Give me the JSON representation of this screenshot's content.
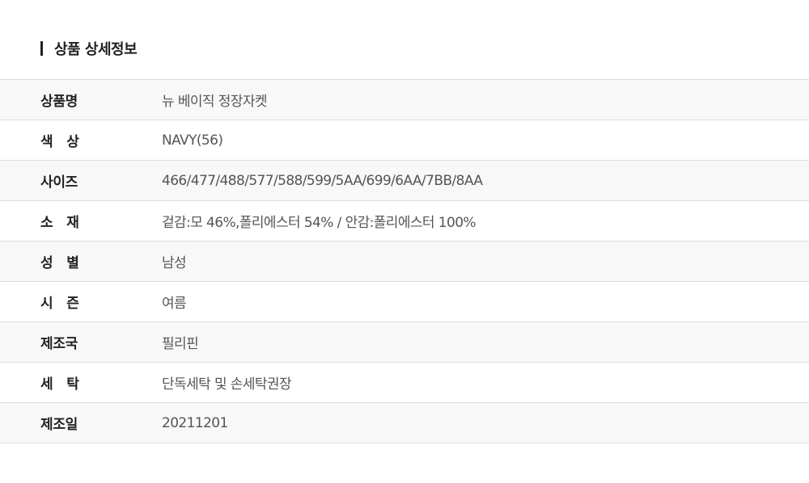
{
  "section": {
    "title": "상품 상세정보"
  },
  "rows": [
    {
      "label": "상품명",
      "value": "뉴 베이직 정장자켓"
    },
    {
      "label": "색   상",
      "value": "NAVY(56)"
    },
    {
      "label": "사이즈",
      "value": "466/477/488/577/588/599/5AA/699/6AA/7BB/8AA"
    },
    {
      "label": "소   재",
      "value": "겉감:모 46%,폴리에스터 54% / 안감:폴리에스터 100%"
    },
    {
      "label": "성   별",
      "value": "남성"
    },
    {
      "label": "시   즌",
      "value": "여름"
    },
    {
      "label": "제조국",
      "value": "필리핀"
    },
    {
      "label": "세   탁",
      "value": "단독세탁 및 손세탁권장"
    },
    {
      "label": "제조일",
      "value": "20211201"
    }
  ]
}
